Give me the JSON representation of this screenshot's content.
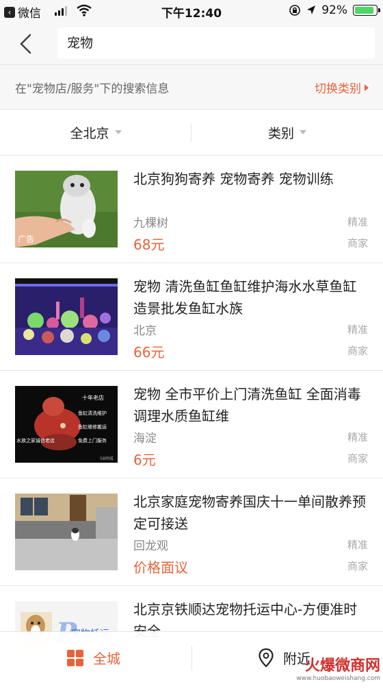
{
  "status_bar": {
    "back_app": "微信",
    "time": "下午12:40",
    "battery_percent": "92%",
    "battery_level": 0.92
  },
  "search": {
    "query": "宠物"
  },
  "category_info": {
    "text": "在\"宠物店/服务\"下的搜索信息",
    "switch_label": "切换类别"
  },
  "filters": {
    "area": "全北京",
    "category": "类别"
  },
  "listings": [
    {
      "title": "北京狗狗寄养 宠物寄养 宠物训练",
      "location": "九棵树",
      "price": "68元",
      "badge_1": "精准",
      "badge_2": "商家",
      "ad_label": "广告",
      "image_icon": "dog-photo"
    },
    {
      "title": "宠物 清洗鱼缸鱼缸维护海水水草鱼缸造景批发鱼缸水族",
      "location": "北京",
      "price": "66元",
      "badge_1": "精准",
      "badge_2": "商家",
      "image_icon": "aquarium-photo"
    },
    {
      "title": "宠物 全市平价上门清洗鱼缸 全面消毒调理水质鱼缸维",
      "location": "海淀",
      "price": "6元",
      "badge_1": "精准",
      "badge_2": "商家",
      "image_icon": "fish-photo",
      "image_text": [
        "十年老店",
        "鱼缸清洗维护",
        "鱼缸维修搬运",
        "免费上门服务",
        "水族之家诚信老店",
        "58同城"
      ]
    },
    {
      "title": "北京家庭宠物寄养国庆十一单间散养预定可接送",
      "location": "回龙观",
      "price": "价格面议",
      "badge_1": "精准",
      "badge_2": "商家",
      "image_icon": "yard-photo"
    },
    {
      "title": "北京京铁顺达宠物托运中心-方便准时安全",
      "image_icon": "pet-shipping-photo",
      "image_text": [
        "宠物托运"
      ]
    }
  ],
  "bottom_bar": {
    "city_label": "全城",
    "nearby_label": "附近"
  },
  "watermark": {
    "name": "火爆微商网",
    "url": "www.huobaoweishang.com"
  },
  "colors": {
    "accent": "#e8633a",
    "header_bg": "#f7f7f7",
    "watermark_red": "#d0312d"
  }
}
